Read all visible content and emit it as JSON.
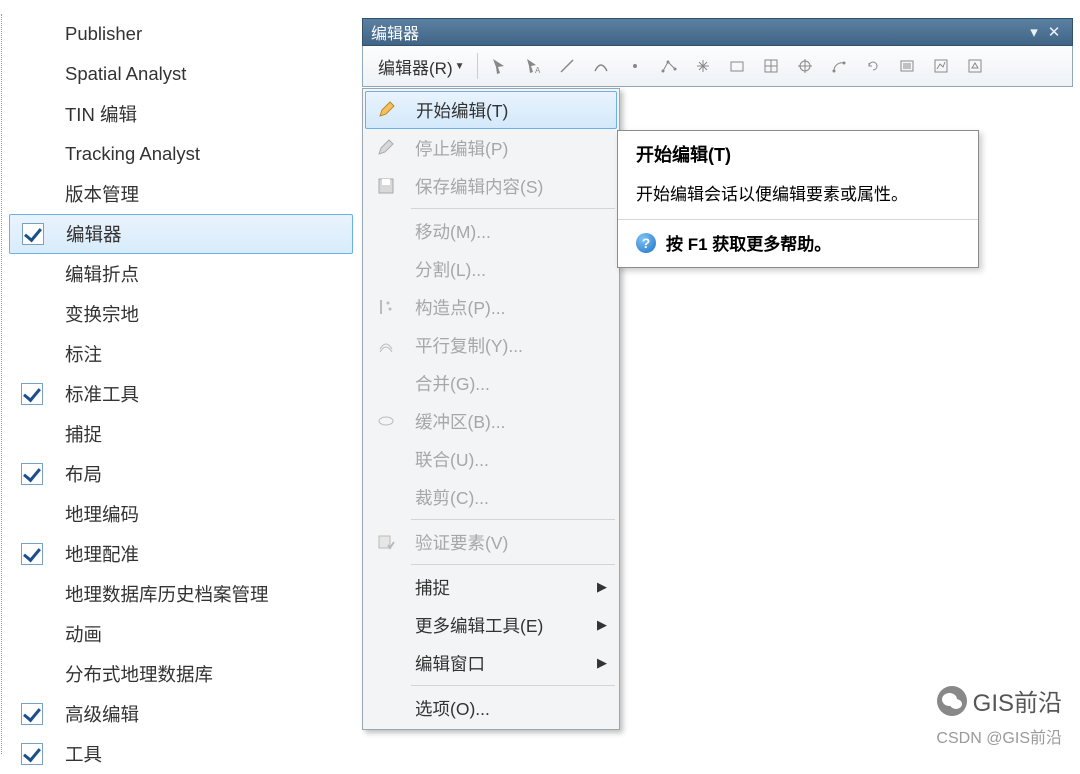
{
  "tree": {
    "items": [
      {
        "label": "Publisher",
        "checked": null
      },
      {
        "label": "Spatial Analyst",
        "checked": null
      },
      {
        "label": "TIN 编辑",
        "checked": null
      },
      {
        "label": "Tracking Analyst",
        "checked": null
      },
      {
        "label": "版本管理",
        "checked": null
      },
      {
        "label": "编辑器",
        "checked": true,
        "selected": true
      },
      {
        "label": "编辑折点",
        "checked": null
      },
      {
        "label": "变换宗地",
        "checked": null
      },
      {
        "label": "标注",
        "checked": null
      },
      {
        "label": "标准工具",
        "checked": true
      },
      {
        "label": "捕捉",
        "checked": null
      },
      {
        "label": "布局",
        "checked": true
      },
      {
        "label": "地理编码",
        "checked": null
      },
      {
        "label": "地理配准",
        "checked": true
      },
      {
        "label": "地理数据库历史档案管理",
        "checked": null
      },
      {
        "label": "动画",
        "checked": null
      },
      {
        "label": "分布式地理数据库",
        "checked": null
      },
      {
        "label": "高级编辑",
        "checked": true
      },
      {
        "label": "工具",
        "checked": true
      }
    ]
  },
  "editor_window": {
    "title": "编辑器",
    "toolbar_menu": "编辑器(R)",
    "toolbar_icons": [
      "edit-arrow",
      "edit-arrow-sub",
      "line-tool",
      "trace-tool",
      "point-tool",
      "vertex-tool",
      "sparkle-tool",
      "rect-tool",
      "grid-tool",
      "target-tool",
      "arc-tool",
      "rotate-tool",
      "list-tool",
      "chart-tool",
      "sketch-tool"
    ]
  },
  "dropdown": {
    "items": [
      {
        "icon": "pencil-icon",
        "label": "开始编辑(T)",
        "enabled": true,
        "highlight": true
      },
      {
        "icon": "pencil2-icon",
        "label": "停止编辑(P)",
        "enabled": false
      },
      {
        "icon": "save-icon",
        "label": "保存编辑内容(S)",
        "enabled": false
      },
      {
        "sep": true
      },
      {
        "icon": "",
        "label": "移动(M)...",
        "enabled": false
      },
      {
        "icon": "",
        "label": "分割(L)...",
        "enabled": false
      },
      {
        "icon": "construct-icon",
        "label": "构造点(P)...",
        "enabled": false
      },
      {
        "icon": "parallel-icon",
        "label": "平行复制(Y)...",
        "enabled": false
      },
      {
        "icon": "",
        "label": "合并(G)...",
        "enabled": false
      },
      {
        "icon": "buffer-icon",
        "label": "缓冲区(B)...",
        "enabled": false
      },
      {
        "icon": "",
        "label": "联合(U)...",
        "enabled": false
      },
      {
        "icon": "",
        "label": "裁剪(C)...",
        "enabled": false
      },
      {
        "sep": true
      },
      {
        "icon": "validate-icon",
        "label": "验证要素(V)",
        "enabled": false
      },
      {
        "sep": true
      },
      {
        "icon": "",
        "label": "捕捉",
        "enabled": true,
        "submenu": true
      },
      {
        "icon": "",
        "label": "更多编辑工具(E)",
        "enabled": true,
        "submenu": true
      },
      {
        "icon": "",
        "label": "编辑窗口",
        "enabled": true,
        "submenu": true
      },
      {
        "sep": true
      },
      {
        "icon": "",
        "label": "选项(O)...",
        "enabled": true
      }
    ]
  },
  "tooltip": {
    "title": "开始编辑(T)",
    "body": "开始编辑会话以便编辑要素或属性。",
    "help": "按 F1 获取更多帮助。"
  },
  "watermark": {
    "brand": "GIS前沿",
    "attribution": "CSDN @GIS前沿"
  }
}
